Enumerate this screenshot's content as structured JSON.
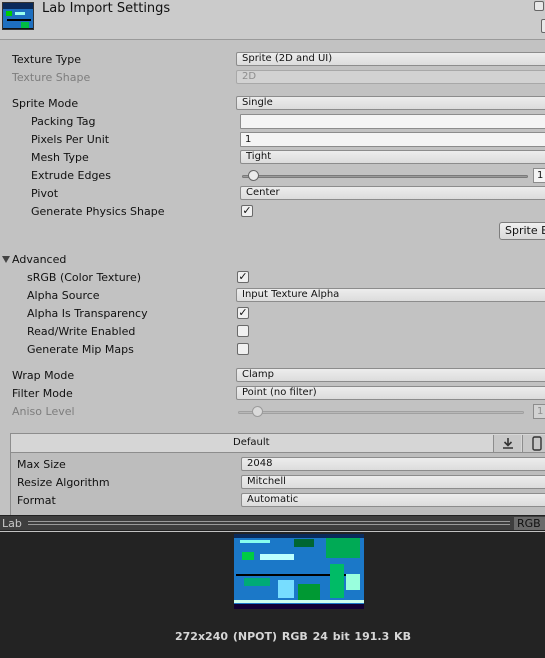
{
  "header": {
    "title": "Lab Import Settings"
  },
  "fields": {
    "texture_type": {
      "label": "Texture Type",
      "value": "Sprite (2D and UI)"
    },
    "texture_shape": {
      "label": "Texture Shape",
      "value": "2D"
    },
    "sprite_mode": {
      "label": "Sprite Mode",
      "value": "Single"
    },
    "packing_tag": {
      "label": "Packing Tag",
      "value": ""
    },
    "pixels_per_unit": {
      "label": "Pixels Per Unit",
      "value": "1"
    },
    "mesh_type": {
      "label": "Mesh Type",
      "value": "Tight"
    },
    "extrude_edges": {
      "label": "Extrude Edges",
      "value": "1",
      "fraction": 0.0
    },
    "pivot": {
      "label": "Pivot",
      "value": "Center"
    },
    "generate_physics_shape": {
      "label": "Generate Physics Shape",
      "checked": true
    },
    "sprite_editor_button": "Sprite E",
    "advanced": {
      "label": "Advanced",
      "expanded": true
    },
    "srgb": {
      "label": "sRGB (Color Texture)",
      "checked": true
    },
    "alpha_source": {
      "label": "Alpha Source",
      "value": "Input Texture Alpha"
    },
    "alpha_is_transparency": {
      "label": "Alpha Is Transparency",
      "checked": true
    },
    "read_write": {
      "label": "Read/Write Enabled",
      "checked": false
    },
    "mip_maps": {
      "label": "Generate Mip Maps",
      "checked": false
    },
    "wrap_mode": {
      "label": "Wrap Mode",
      "value": "Clamp"
    },
    "filter_mode": {
      "label": "Filter Mode",
      "value": "Point (no filter)"
    },
    "aniso_level": {
      "label": "Aniso Level",
      "value": "1",
      "fraction": 0.0
    }
  },
  "platform": {
    "tab_label": "Default",
    "max_size": {
      "label": "Max Size",
      "value": "2048"
    },
    "resize_algorithm": {
      "label": "Resize Algorithm",
      "value": "Mitchell"
    },
    "format": {
      "label": "Format",
      "value": "Automatic"
    }
  },
  "preview": {
    "label": "Lab",
    "channel": "RGB",
    "info": "272x240 (NPOT)  RGB 24 bit  191.3 KB"
  },
  "colors": {
    "accent_check": "#111111",
    "preview_bg": "#232323",
    "image_blue": "#1b78c8"
  }
}
